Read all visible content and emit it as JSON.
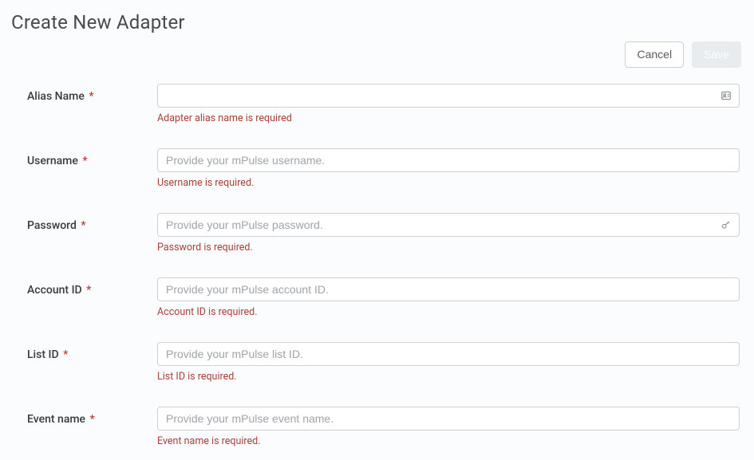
{
  "header": {
    "title": "Create New Adapter"
  },
  "actions": {
    "cancel": "Cancel",
    "save": "Save"
  },
  "form": {
    "fields": [
      {
        "label": "Alias Name",
        "required": true,
        "placeholder": "",
        "value": "",
        "error": "Adapter alias name is required",
        "icon": "contact-card-icon"
      },
      {
        "label": "Username",
        "required": true,
        "placeholder": "Provide your mPulse username.",
        "value": "",
        "error": "Username is required.",
        "icon": null
      },
      {
        "label": "Password",
        "required": true,
        "placeholder": "Provide your mPulse password.",
        "value": "",
        "error": "Password is required.",
        "icon": "key-icon"
      },
      {
        "label": "Account ID",
        "required": true,
        "placeholder": "Provide your mPulse account ID.",
        "value": "",
        "error": "Account ID is required.",
        "icon": null
      },
      {
        "label": "List ID",
        "required": true,
        "placeholder": "Provide your mPulse list ID.",
        "value": "",
        "error": "List ID is required.",
        "icon": null
      },
      {
        "label": "Event name",
        "required": true,
        "placeholder": "Provide your mPulse event name.",
        "value": "",
        "error": "Event name is required.",
        "icon": null
      }
    ]
  }
}
